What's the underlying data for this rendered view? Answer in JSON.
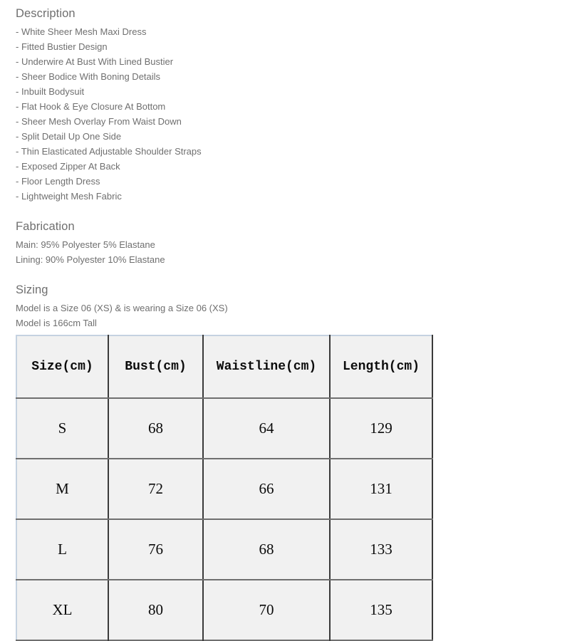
{
  "description": {
    "heading": "Description",
    "items": [
      "- White Sheer Mesh Maxi Dress",
      "- Fitted Bustier Design",
      "- Underwire At Bust With Lined Bustier",
      "- Sheer Bodice With Boning Details",
      "- Inbuilt Bodysuit",
      "- Flat Hook & Eye Closure At Bottom",
      "- Sheer Mesh Overlay From Waist Down",
      "- Split Detail Up One Side",
      "- Thin Elasticated Adjustable Shoulder Straps",
      "- Exposed Zipper At Back",
      "- Floor Length Dress",
      "- Lightweight Mesh Fabric"
    ]
  },
  "fabrication": {
    "heading": "Fabrication",
    "main": "Main: 95% Polyester 5% Elastane",
    "lining": "Lining: 90% Polyester 10% Elastane"
  },
  "sizing": {
    "heading": "Sizing",
    "model_note_1": "Model is a Size 06 (XS) & is wearing a Size 06 (XS)",
    "model_note_2": "Model is 166cm Tall",
    "table": {
      "headers": [
        "Size(cm)",
        "Bust(cm)",
        "Waistline(cm)",
        "Length(cm)"
      ],
      "rows": [
        [
          "S",
          "68",
          "64",
          "129"
        ],
        [
          "M",
          "72",
          "66",
          "131"
        ],
        [
          "L",
          "76",
          "68",
          "133"
        ],
        [
          "XL",
          "80",
          "70",
          "135"
        ]
      ]
    }
  },
  "colors": {
    "body_text": "#6f6f6f",
    "table_text": "#0b0b0b",
    "cell_background": "#f1f1f1",
    "outer_border": "#c5d2e1",
    "inner_border": "#3a3a3a",
    "row_border": "#6f6f6f",
    "page_background": "#ffffff"
  }
}
